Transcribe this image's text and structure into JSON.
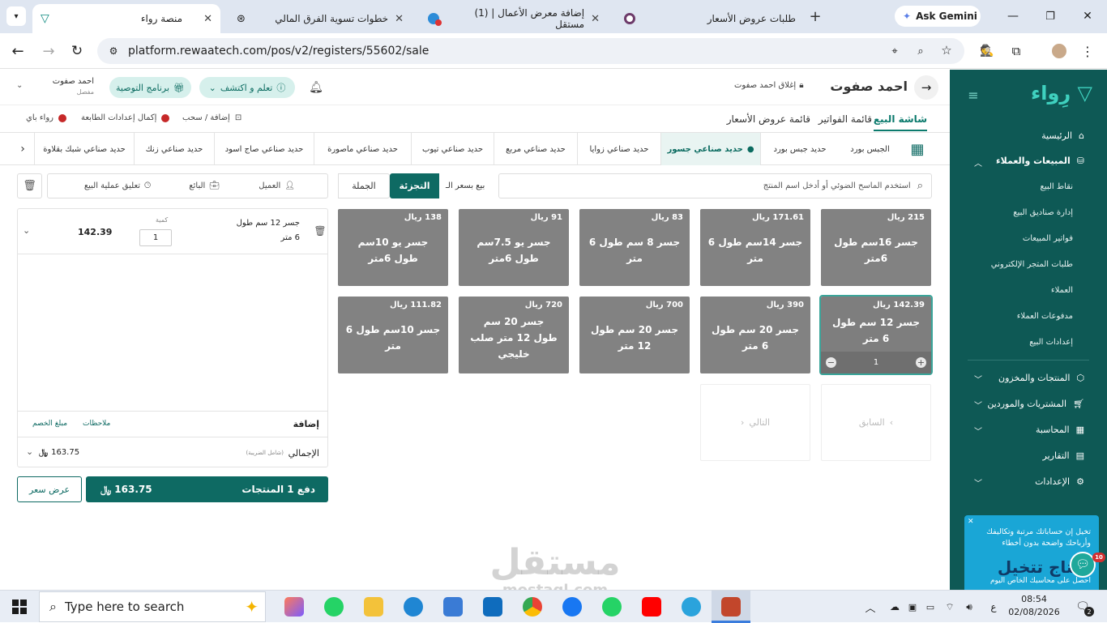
{
  "browser": {
    "tabs": [
      {
        "title": "منصة رواء",
        "active": true
      },
      {
        "title": "خطوات تسوية الفرق المالي",
        "active": false
      },
      {
        "title": "(1) إضافة معرض الأعمال | مستقل",
        "active": false
      },
      {
        "title": "طلبات عروض الأسعار",
        "active": false
      }
    ],
    "gemini_label": "Ask Gemini",
    "url": "platform.rewaatech.com/pos/v2/registers/55602/sale"
  },
  "header": {
    "user_name": "احمد صفوت",
    "close_label": "إغلاق احمد صفوت",
    "learn_label": "تعلم و اكتشف",
    "referral_label": "برنامج التوصية",
    "account_name": "احمد صفوت",
    "account_role": "مفصل"
  },
  "nav": {
    "tabs": [
      "شاشة البيع",
      "قائمة الفواتير",
      "قائمة عروض الأسعار"
    ],
    "add_withdraw": "إضافة / سحب",
    "printer_setup": "إكمال إعدادات الطابعة",
    "rewaa_pay": "رواء باي"
  },
  "categories": [
    "الجبس بورد",
    "حديد جبس بورد",
    "حديد صناعي جسور",
    "حديد صناعي زوايا",
    "حديد صناعي مربع",
    "حديد صناعي تيوب",
    "حديد صناعي ماصورة",
    "حديد صناعي صاج اسود",
    "حديد صناعي زنك",
    "حديد صناعي شبك بقلاوة"
  ],
  "sale": {
    "search_placeholder": "استخدم الماسح الضوئي أو أدخل اسم المنتج",
    "price_label": "بيع بسعر الـ",
    "retail": "التجزئة",
    "wholesale": "الجملة",
    "customer": "العميل",
    "seller": "البائع",
    "hold": "تعليق عملية البيع"
  },
  "products": [
    {
      "price": "215 ريال",
      "name": "جسر 16سم طول 6متر"
    },
    {
      "price": "171.61 ريال",
      "name": "جسر 14سم طول 6 متر"
    },
    {
      "price": "83 ريال",
      "name": "جسر 8 سم طول 6 متر"
    },
    {
      "price": "91 ريال",
      "name": "جسر يو 7.5سم طول 6متر"
    },
    {
      "price": "138 ريال",
      "name": "جسر يو 10سم طول 6متر"
    },
    {
      "price": "142.39 ريال",
      "name": "جسر 12 سم طول 6 متر",
      "qty": "1"
    },
    {
      "price": "390 ريال",
      "name": "جسر 20 سم طول 6 متر"
    },
    {
      "price": "700 ريال",
      "name": "جسر 20 سم طول 12 متر"
    },
    {
      "price": "720 ريال",
      "name": "جسر 20 سم طول 12 متر صلب خليجي"
    },
    {
      "price": "111.82 ريال",
      "name": "جسر 10سم طول 6 متر"
    }
  ],
  "pager": {
    "prev": "السابق",
    "next": "التالي"
  },
  "cart": {
    "item_name": "جسر 12 سم طول",
    "item_name2": "6 متر",
    "qty_label": "كمية",
    "qty": "1",
    "line_total": "142.39",
    "add_label": "إضافة",
    "notes": "ملاحظات",
    "discount": "مبلغ الخصم",
    "total_label": "الإجمالي",
    "tax_note": "(شامل الضريبة)",
    "total": "163.75",
    "pay_label": "دفع 1 المنتجات",
    "pay_amount": "163.75",
    "quote": "عرض سعر"
  },
  "sidebar": {
    "home": "الرئيسية",
    "sales_group": "المبيعات والعملاء",
    "subitems": [
      "نقاط البيع",
      "إدارة صناديق البيع",
      "فواتير المبيعات",
      "طلبات المتجر الإلكتروني",
      "العملاء",
      "مدفوعات العملاء",
      "إعدادات البيع"
    ],
    "products": "المنتجات والمخزون",
    "purchases": "المشتريات والموردين",
    "accounting": "المحاسبة",
    "reports": "التقارير",
    "settings": "الإعدادات",
    "promo_text": "تخيل إن حساباتك مرتبة وتكاليفك وأرباحك واضحة بدون أخطاء",
    "promo_headline": "يحتاج تتخيل",
    "promo_sub": "احصل على محاسبك الخاص اليوم",
    "chat_badge": "10"
  },
  "watermark": {
    "main": "مستقل",
    "sub": "mostaql.com"
  },
  "taskbar": {
    "search_placeholder": "Type here to search",
    "time": "08:54",
    "date": "02/08/2026",
    "lang": "ع",
    "notif": "2"
  },
  "colors": {
    "brand": "#0e5955",
    "accent": "#0e6a63",
    "product": "#828282"
  }
}
